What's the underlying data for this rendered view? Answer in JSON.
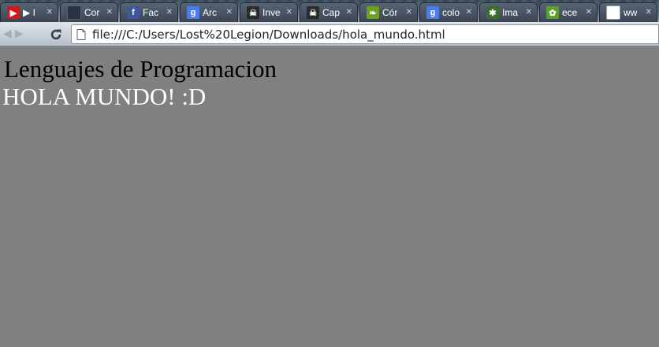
{
  "browser": {
    "tabs": [
      {
        "label": "▶ I",
        "icon": "youtube-icon",
        "color": "#cc181e"
      },
      {
        "label": "Cor",
        "icon": "dark-site-icon",
        "color": "#2a3440"
      },
      {
        "label": "Fac",
        "icon": "facebook-icon",
        "color": "#3b5998"
      },
      {
        "label": "Arc",
        "icon": "google-icon",
        "color": "#4a7ef0"
      },
      {
        "label": "Inve",
        "icon": "pirate-icon",
        "color": "#2b2b2b"
      },
      {
        "label": "Cap",
        "icon": "pirate-icon",
        "color": "#2b2b2b"
      },
      {
        "label": "Cór",
        "icon": "leaf-icon",
        "color": "#6aa121"
      },
      {
        "label": "colo",
        "icon": "google-icon",
        "color": "#4a7ef0"
      },
      {
        "label": "Ima",
        "icon": "sparkle-icon",
        "color": "#3b6e2b"
      },
      {
        "label": "ece",
        "icon": "paw-icon",
        "color": "#5aa02c"
      },
      {
        "label": "ww",
        "icon": "page-icon",
        "color": "#ffffff"
      }
    ],
    "address": {
      "url": "file:///C:/Users/Lost%20Legion/Downloads/hola_mundo.html"
    }
  },
  "page": {
    "line1": "Lenguajes de Programacion",
    "line2": "HOLA MUNDO! :D",
    "background": "#808080"
  }
}
